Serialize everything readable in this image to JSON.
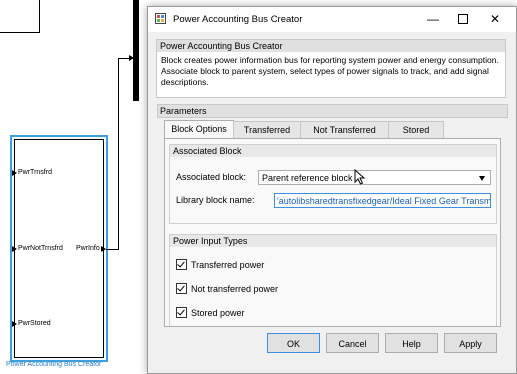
{
  "canvas": {
    "block": {
      "ports_in": [
        "PwrTrnsfrd",
        "PwrNotTrnsfrd",
        "PwrStored"
      ],
      "port_out": "PwrInfo",
      "caption": "Power Accounting Bus Creator"
    }
  },
  "dialog": {
    "title": "Power Accounting Bus Creator",
    "window_controls": {
      "minimize": "—",
      "close": "✕"
    },
    "description": {
      "header": "Power Accounting Bus Creator",
      "text": "Block creates power information bus for reporting system power and energy consumption. Associate block to parent system, select types of power signals to track, and add signal descriptions."
    },
    "parameters": {
      "header": "Parameters",
      "tabs": [
        "Block Options",
        "Transferred",
        "Not Transferred",
        "Stored"
      ],
      "active_tab": "Block Options",
      "associated_block": {
        "header": "Associated Block",
        "label": "Associated block:",
        "value": "Parent reference block",
        "library_label": "Library block name:",
        "library_value": "'autolibsharedtransfixedgear/Ideal Fixed Gear Transmission'"
      },
      "power_input_types": {
        "header": "Power Input Types",
        "options": [
          {
            "label": "Transferred power",
            "checked": true
          },
          {
            "label": "Not transferred power",
            "checked": true
          },
          {
            "label": "Stored power",
            "checked": true
          }
        ]
      }
    },
    "buttons": {
      "ok": "OK",
      "cancel": "Cancel",
      "help": "Help",
      "apply": "Apply"
    }
  },
  "colors": {
    "selection": "#3d9fdc",
    "caption": "#2b7bd0",
    "accent": "#3d8de0"
  }
}
